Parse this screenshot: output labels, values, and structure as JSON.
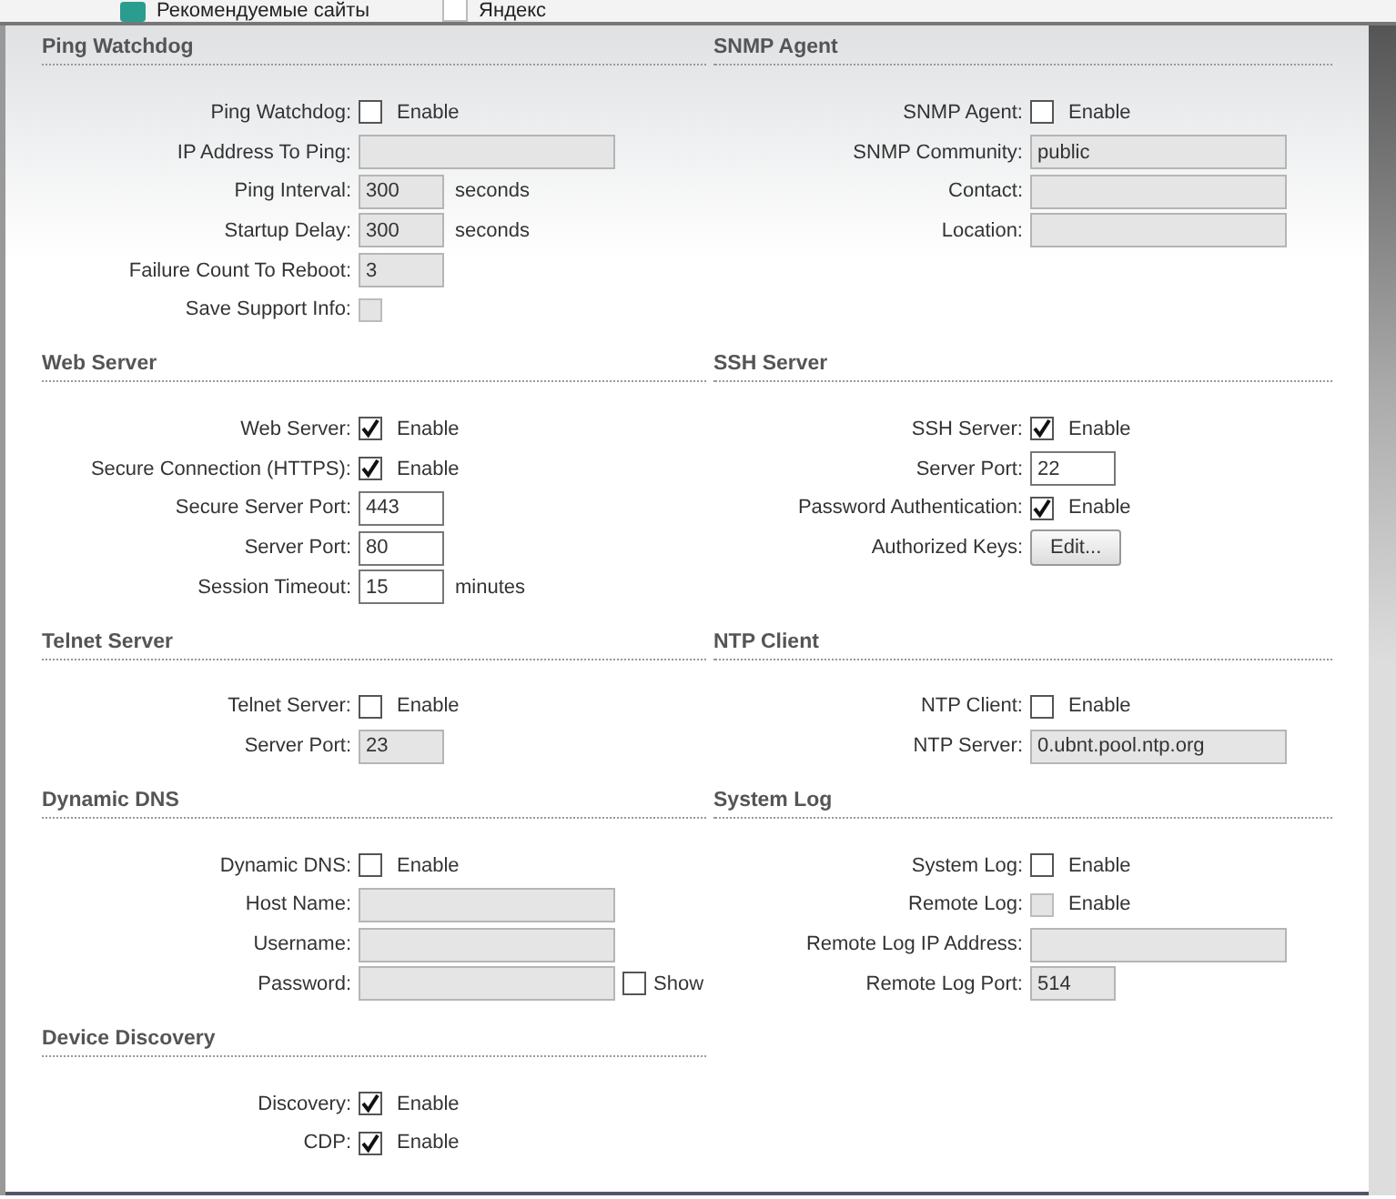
{
  "bookmarks": [
    {
      "label": "Рекомендуемые сайты",
      "kind": "tile"
    },
    {
      "label": "Яндекс",
      "kind": "ya"
    }
  ],
  "rows": [
    {
      "sections": [
        {
          "title": "Ping Watchdog",
          "fields": [
            {
              "kind": "checkbox",
              "label": "Ping Watchdog:",
              "text": "Enable",
              "checked": false,
              "disabled": false
            },
            {
              "kind": "long-field",
              "label": "IP Address To Ping:",
              "disabled": true
            },
            {
              "kind": "short-field",
              "label": "Ping Interval:",
              "value": "300",
              "unit": "seconds",
              "disabled": true
            },
            {
              "kind": "short-field",
              "label": "Startup Delay:",
              "value": "300",
              "unit": "seconds",
              "disabled": true
            },
            {
              "kind": "short-field",
              "label": "Failure Count To Reboot:",
              "value": "3",
              "disabled": true
            },
            {
              "kind": "checkbox",
              "label": "Save Support Info:",
              "checked": false,
              "disabled": true
            }
          ]
        },
        {
          "title": "SNMP Agent",
          "fields": [
            {
              "kind": "checkbox",
              "label": "SNMP Agent:",
              "text": "Enable",
              "checked": false,
              "disabled": false
            },
            {
              "kind": "long-field",
              "label": "SNMP Community:",
              "value": "public",
              "disabled": true
            },
            {
              "kind": "long-field",
              "label": "Contact:",
              "disabled": true
            },
            {
              "kind": "long-field",
              "label": "Location:",
              "disabled": true
            }
          ]
        }
      ]
    },
    {
      "sections": [
        {
          "title": "Web Server",
          "fields": [
            {
              "kind": "checkbox",
              "label": "Web Server:",
              "text": "Enable",
              "checked": true,
              "disabled": false
            },
            {
              "kind": "checkbox",
              "label": "Secure Connection (HTTPS):",
              "text": "Enable",
              "checked": true,
              "disabled": false
            },
            {
              "kind": "short-field",
              "label": "Secure Server Port:",
              "value": "443",
              "disabled": false
            },
            {
              "kind": "short-field",
              "label": "Server Port:",
              "value": "80",
              "disabled": false
            },
            {
              "kind": "short-field",
              "label": "Session Timeout:",
              "value": "15",
              "unit": "minutes",
              "disabled": false
            }
          ]
        },
        {
          "title": "SSH Server",
          "fields": [
            {
              "kind": "checkbox",
              "label": "SSH Server:",
              "text": "Enable",
              "checked": true,
              "disabled": false
            },
            {
              "kind": "short-field",
              "label": "Server Port:",
              "value": "22",
              "disabled": false
            },
            {
              "kind": "checkbox",
              "label": "Password Authentication:",
              "text": "Enable",
              "checked": true,
              "disabled": false
            },
            {
              "kind": "button",
              "label": "Authorized Keys:",
              "text": "Edit..."
            }
          ]
        }
      ]
    },
    {
      "sections": [
        {
          "title": "Telnet Server",
          "fields": [
            {
              "kind": "checkbox",
              "label": "Telnet Server:",
              "text": "Enable",
              "checked": false,
              "disabled": false
            },
            {
              "kind": "short-field",
              "label": "Server Port:",
              "value": "23",
              "disabled": true
            }
          ]
        },
        {
          "title": "NTP Client",
          "fields": [
            {
              "kind": "checkbox",
              "label": "NTP Client:",
              "text": "Enable",
              "checked": false,
              "disabled": false
            },
            {
              "kind": "long-field",
              "label": "NTP Server:",
              "value": "0.ubnt.pool.ntp.org",
              "disabled": true
            }
          ]
        }
      ]
    },
    {
      "sections": [
        {
          "title": "Dynamic DNS",
          "fields": [
            {
              "kind": "checkbox",
              "label": "Dynamic DNS:",
              "text": "Enable",
              "checked": false,
              "disabled": false
            },
            {
              "kind": "long-field",
              "label": "Host Name:",
              "disabled": true
            },
            {
              "kind": "long-field",
              "label": "Username:",
              "disabled": true
            },
            {
              "kind": "long-field",
              "label": "Password:",
              "disabled": true,
              "toggle": {
                "text": "Show",
                "checked": false
              }
            }
          ]
        },
        {
          "title": "System Log",
          "fields": [
            {
              "kind": "checkbox",
              "label": "System Log:",
              "text": "Enable",
              "checked": false,
              "disabled": false
            },
            {
              "kind": "checkbox",
              "label": "Remote Log:",
              "text": "Enable",
              "checked": false,
              "disabled": true
            },
            {
              "kind": "long-field",
              "label": "Remote Log IP Address:",
              "disabled": true
            },
            {
              "kind": "short-field",
              "label": "Remote Log Port:",
              "value": "514",
              "disabled": true
            }
          ]
        }
      ]
    },
    {
      "sections": [
        {
          "title": "Device Discovery",
          "fields": [
            {
              "kind": "checkbox",
              "label": "Discovery:",
              "text": "Enable",
              "checked": true,
              "disabled": false
            },
            {
              "kind": "checkbox",
              "label": "CDP:",
              "text": "Enable",
              "checked": true,
              "disabled": false
            }
          ]
        }
      ]
    }
  ]
}
